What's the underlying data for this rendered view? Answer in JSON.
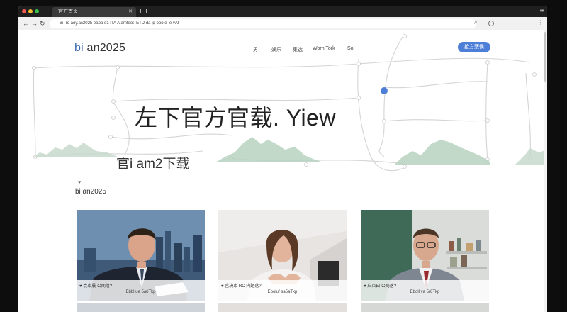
{
  "browser": {
    "tab_title": "官方首页",
    "tab_close": "✕",
    "url": "Bi  ro  aoy.ac2025 eaba e1 ITA A amteot  ETD da jq ooo e  e vAt",
    "back": "←",
    "forward": "→",
    "reload": "↻",
    "search_icon": "⌕",
    "menu_icon": "⋮",
    "wifi": "≋",
    "colors": {
      "close": "#ee5a52",
      "minimize": "#f5bd2f",
      "maximize": "#35c04a"
    }
  },
  "site": {
    "logo_prefix": "bi",
    "logo_suffix": " an2025",
    "nav": [
      "男",
      "娱乐",
      "集选",
      "Worn Tork",
      "Sol"
    ],
    "cta": "抢方菠侯",
    "accent_color": "#4d7fd8"
  },
  "hero": {
    "title": "左下官方官载. Yiew",
    "subtitle": "官i am2下载"
  },
  "section": {
    "icon": "♥",
    "title": "bi an2025"
  },
  "cards": [
    {
      "caption_line1": "♥ 袁束晨 公闻落?",
      "caption_line2": "Ebbl ue 5a6Tkp"
    },
    {
      "caption_line1": "♥ 宫决束 RC 内题落?",
      "caption_line2": "Eboluf sa5aTkp"
    },
    {
      "caption_line1": "♥ 启束曰 公局落?",
      "caption_line2": "Eboll va 5r6Tkp"
    }
  ]
}
